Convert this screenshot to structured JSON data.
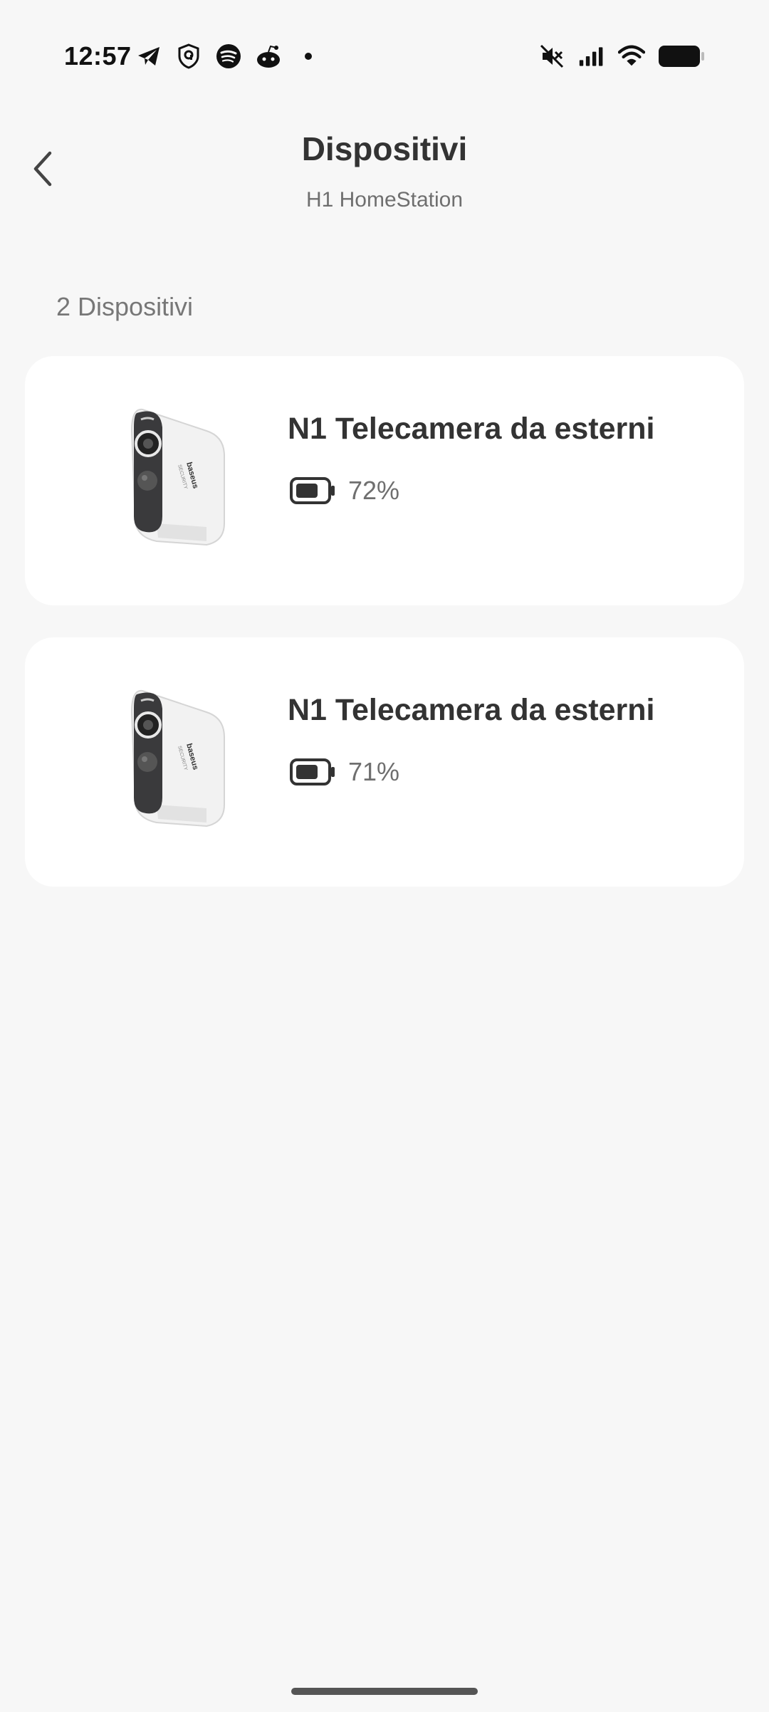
{
  "status_bar": {
    "time": "12:57",
    "left_icons": [
      "telegram-icon",
      "shield-icon",
      "spotify-icon",
      "reddit-icon",
      "dot-icon"
    ],
    "right_icons": [
      "mute-icon",
      "signal-icon",
      "wifi-icon",
      "battery-icon"
    ]
  },
  "header": {
    "title": "Dispositivi",
    "subtitle": "H1 HomeStation"
  },
  "device_count": "2 Dispositivi",
  "devices": [
    {
      "name": "N1 Telecamera da esterni",
      "battery": "72%",
      "battery_level": 0.72
    },
    {
      "name": "N1 Telecamera da esterni",
      "battery": "71%",
      "battery_level": 0.71
    }
  ]
}
